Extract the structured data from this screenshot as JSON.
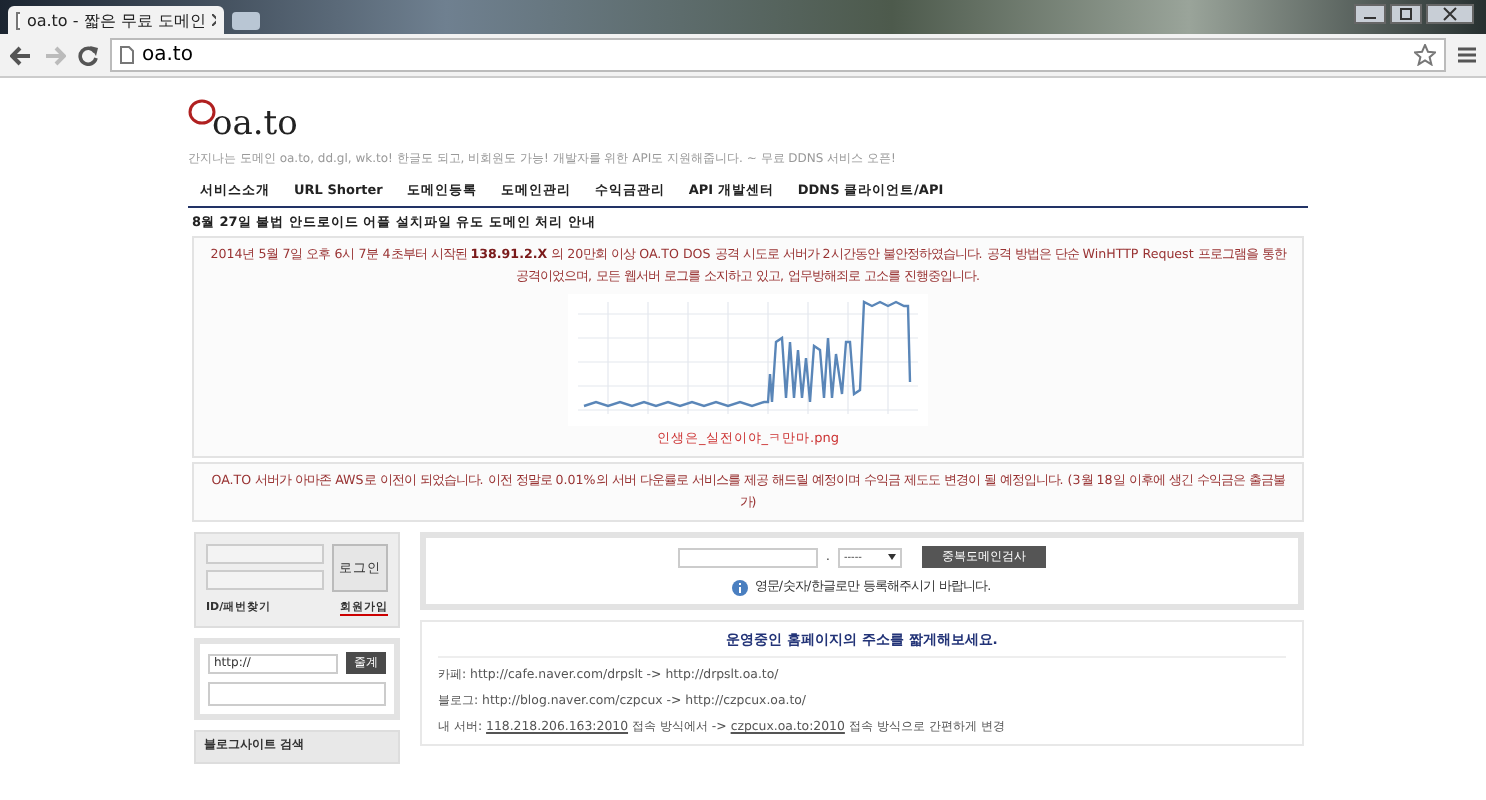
{
  "browser": {
    "tab_title": "oa.to - 짧은 무료 도메인",
    "address": "oa.to"
  },
  "header": {
    "logo": "oa.to",
    "tagline": "간지나는 도메인 oa.to, dd.gl, wk.to! 한글도 되고, 비회원도 가능! 개발자를 위한 API도 지원해줍니다. ~ 무료 DDNS 서비스 오픈!",
    "nav": [
      "서비스소개",
      "URL Shorter",
      "도메인등록",
      "도메인관리",
      "수익금관리",
      "API 개발센터",
      "DDNS 클라이언트/API"
    ]
  },
  "notice_link": "8월 27일 불법 안드로이드 어플 설치파일 유도 도메인 처리 안내",
  "alerts": [
    {
      "text": "2014년 5월 7일 오후 6시 7분 4초부터 시작된 **138.91.2.X** 의 20만회 이상 OA.TO DOS 공격 시도로 서버가 2시간동안 불안정하였습니다. 공격 방법은 단순 WinHTTP Request 프로그램을 통한 공격이었으며, 모든 웹서버 로그를 소지하고 있고, 업무방해죄로 고소를 진행중입니다.",
      "image_caption": "인생은_실전이야_ㅋ만마.png"
    },
    {
      "text": "OA.TO 서버가 아마존 AWS로 이전이 되었습니다. 이전 정말로 0.01%의 서버 다운률로 서비스를 제공 해드릴 예정이며 수익금 제도도 변경이 될 예정입니다. (3월 18일 이후에 생긴 수익금은 출금불가)"
    }
  ],
  "login": {
    "button": "로그인",
    "find_label": "ID/패번찾기",
    "signup_link": "회원가입"
  },
  "shorten": {
    "value": "http://",
    "button": "줄계"
  },
  "sidebar_heading": "블로그사이트 검색",
  "domain_search": {
    "separator": ".",
    "select_value": "-----",
    "button": "중복도메인검사",
    "hint": "영문/숫자/한글로만 등록해주시기 바랍니다."
  },
  "showcase": {
    "title": "운영중인 홈페이지의 주소를 짧게해보세요.",
    "lines": [
      [
        {
          "text": "카페: http://cafe.naver.com/drpslt -> http://drpslt.oa.to/",
          "link": false
        }
      ],
      [
        {
          "text": "블로그: http://blog.naver.com/czpcux -> http://czpcux.oa.to/",
          "link": false
        }
      ],
      [
        {
          "text": "내 서버: ",
          "link": false
        },
        {
          "text": "118.218.206.163:2010",
          "link": true
        },
        {
          "text": " 접속 방식에서 -> ",
          "link": false
        },
        {
          "text": "czpcux.oa.to:2010",
          "link": true
        },
        {
          "text": " 접속 방식으로 간편하게 변경",
          "link": false
        }
      ]
    ]
  }
}
